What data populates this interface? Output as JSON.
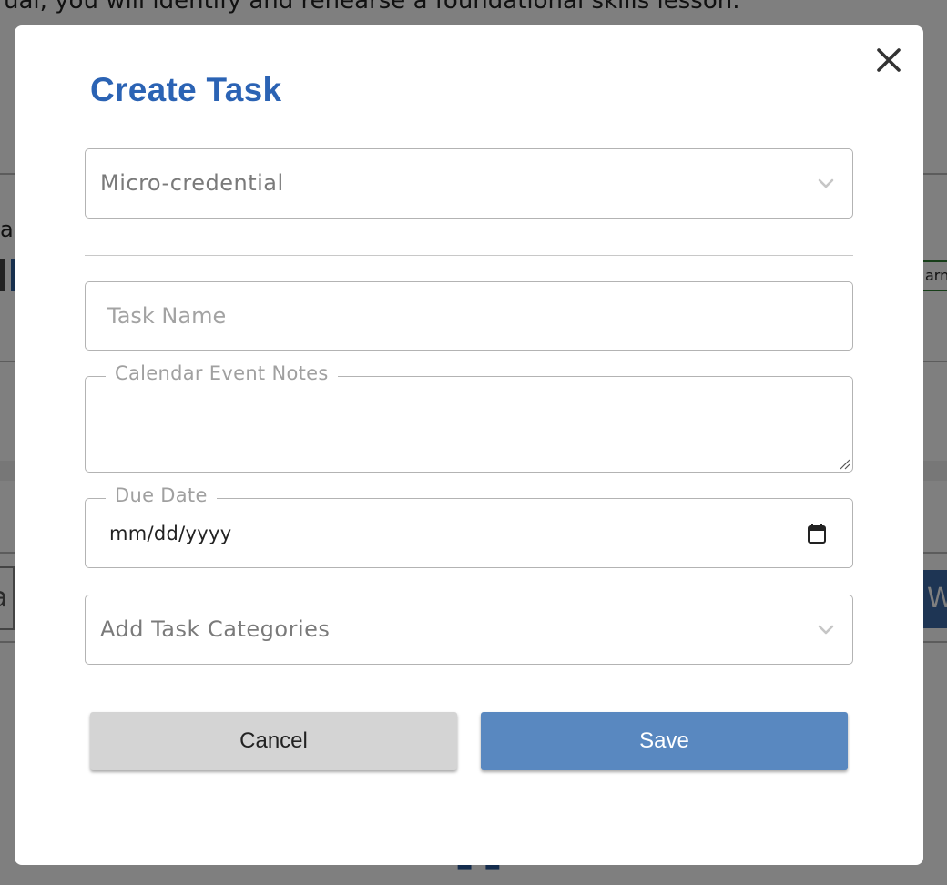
{
  "modal": {
    "title": "Create Task",
    "close_icon": "close-icon",
    "micro_credential_select": {
      "value": "Micro-credential",
      "icon": "chevron-down-icon"
    },
    "task_name": {
      "placeholder": "Task Name",
      "value": ""
    },
    "calendar_notes": {
      "label": "Calendar Event Notes",
      "value": ""
    },
    "due_date": {
      "label": "Due Date",
      "value": "mm/dd/yyyy",
      "icon": "calendar-icon"
    },
    "categories_select": {
      "placeholder": "Add Task Categories",
      "icon": "chevron-down-icon"
    },
    "buttons": {
      "cancel": "Cancel",
      "save": "Save"
    }
  },
  "background": {
    "top_text": "ual, you will identify and rehearse a foundational skills lesson.",
    "left_fragment": "ag",
    "right_fragment": "arn",
    "button_fragment": "W",
    "input_fragment": "a"
  },
  "colors": {
    "title": "#2b63b4",
    "save_button": "#5988c0",
    "cancel_button": "#d4d4d4"
  }
}
